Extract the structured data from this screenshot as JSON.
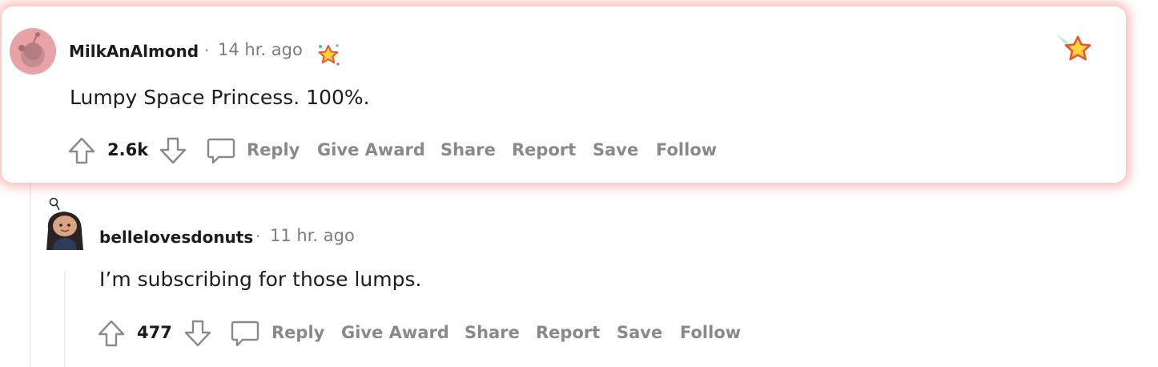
{
  "comments": [
    {
      "author": "MilkAnAlmond",
      "separator": "·",
      "time": "14 hr. ago",
      "text": "Lumpy Space Princess. 100%.",
      "votes": "2.6k",
      "actions": {
        "reply": "Reply",
        "give_award": "Give Award",
        "share": "Share",
        "report": "Report",
        "save": "Save",
        "follow": "Follow"
      },
      "highlighted": true
    },
    {
      "author": "bellelovesdonuts",
      "separator": "·",
      "time": "11 hr. ago",
      "text": "I’m subscribing for those lumps.",
      "votes": "477",
      "actions": {
        "reply": "Reply",
        "give_award": "Give Award",
        "share": "Share",
        "report": "Report",
        "save": "Save",
        "follow": "Follow"
      },
      "highlighted": false
    }
  ],
  "colors": {
    "highlight_glow": "#ee7870",
    "avatar_bg": "#e9a3a8",
    "action_text": "#878a8c",
    "thread_line": "#edeff1"
  },
  "icons": [
    "upvote-icon",
    "downvote-icon",
    "comment-bubble-icon",
    "award-icon",
    "featured-star-icon",
    "snoo-avatar-icon"
  ]
}
